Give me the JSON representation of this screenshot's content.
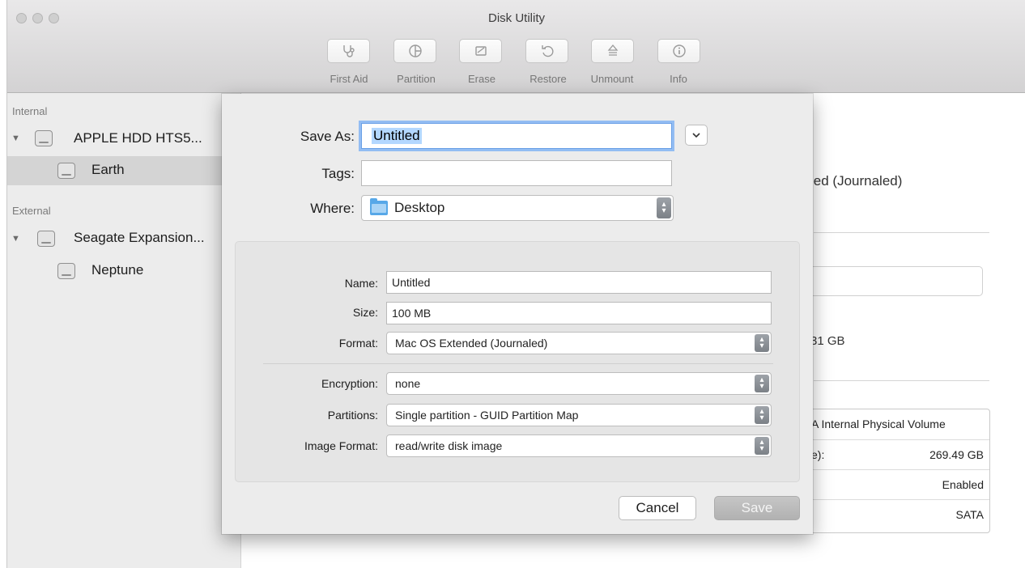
{
  "window": {
    "title": "Disk Utility"
  },
  "toolbar": {
    "items": [
      {
        "label": "First Aid",
        "icon": "stethoscope-icon"
      },
      {
        "label": "Partition",
        "icon": "partition-icon"
      },
      {
        "label": "Erase",
        "icon": "erase-icon"
      },
      {
        "label": "Restore",
        "icon": "restore-icon"
      },
      {
        "label": "Unmount",
        "icon": "unmount-icon"
      },
      {
        "label": "Info",
        "icon": "info-icon"
      }
    ]
  },
  "sidebar": {
    "internal_header": "Internal",
    "external_header": "External",
    "internal_disk": "APPLE HDD HTS5...",
    "internal_volume": "Earth",
    "external_disk": "Seagate Expansion...",
    "external_volume": "Neptune"
  },
  "main": {
    "format_text": "led (Journaled)",
    "capacity_text": "31 GB",
    "info": [
      {
        "key": "A Internal Physical Volume",
        "value": ""
      },
      {
        "key": "e):",
        "value": "269.49 GB"
      },
      {
        "key": "",
        "value": "Enabled"
      },
      {
        "key": "",
        "value": "SATA"
      }
    ]
  },
  "dialog": {
    "save_as_label": "Save As:",
    "save_as_value": "Untitled",
    "tags_label": "Tags:",
    "tags_value": "",
    "where_label": "Where:",
    "where_value": "Desktop",
    "name_label": "Name:",
    "name_value": "Untitled",
    "size_label": "Size:",
    "size_value": "100 MB",
    "format_label": "Format:",
    "format_value": "Mac OS Extended (Journaled)",
    "encryption_label": "Encryption:",
    "encryption_value": "none",
    "partitions_label": "Partitions:",
    "partitions_value": "Single partition - GUID Partition Map",
    "image_format_label": "Image Format:",
    "image_format_value": "read/write disk image",
    "cancel_label": "Cancel",
    "save_label": "Save"
  }
}
